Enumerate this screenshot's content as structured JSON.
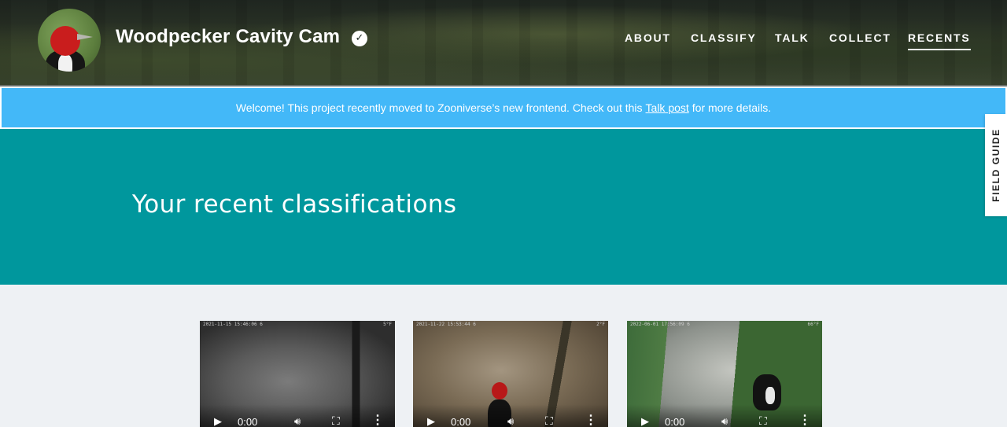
{
  "header": {
    "project_title": "Woodpecker Cavity Cam",
    "avatar_icon": "woodpecker-avatar",
    "verified_icon": "check-badge-icon",
    "nav": [
      {
        "label": "ABOUT",
        "active": false
      },
      {
        "label": "CLASSIFY",
        "active": false
      },
      {
        "label": "TALK",
        "active": false
      },
      {
        "label": "COLLECT",
        "active": false
      },
      {
        "label": "RECENTS",
        "active": true
      }
    ]
  },
  "banner": {
    "text_before": "Welcome! This project recently moved to Zooniverse’s new frontend. Check out this",
    "link_text": "Talk post",
    "text_after": "for more details.",
    "color": "#43b8f8"
  },
  "hero": {
    "title": "Your recent classifications",
    "color": "#00979d"
  },
  "field_guide": {
    "label": "FIELD GUIDE"
  },
  "recents": [
    {
      "timestamp": "2021-11-15  15:46:06   6",
      "temp": "5°F",
      "time": "0:00",
      "scene": "night"
    },
    {
      "timestamp": "2021-11-22  15:53:44   6",
      "temp": "2°F",
      "time": "0:00",
      "scene": "bird-day"
    },
    {
      "timestamp": "2022-06-01  17:56:09   6",
      "temp": "66°F",
      "time": "0:00",
      "scene": "bird-summer"
    }
  ],
  "video_controls": {
    "play_icon": "play-icon",
    "volume_icon": "volume-icon",
    "fullscreen_icon": "fullscreen-icon",
    "more_icon": "more-vertical-icon"
  }
}
